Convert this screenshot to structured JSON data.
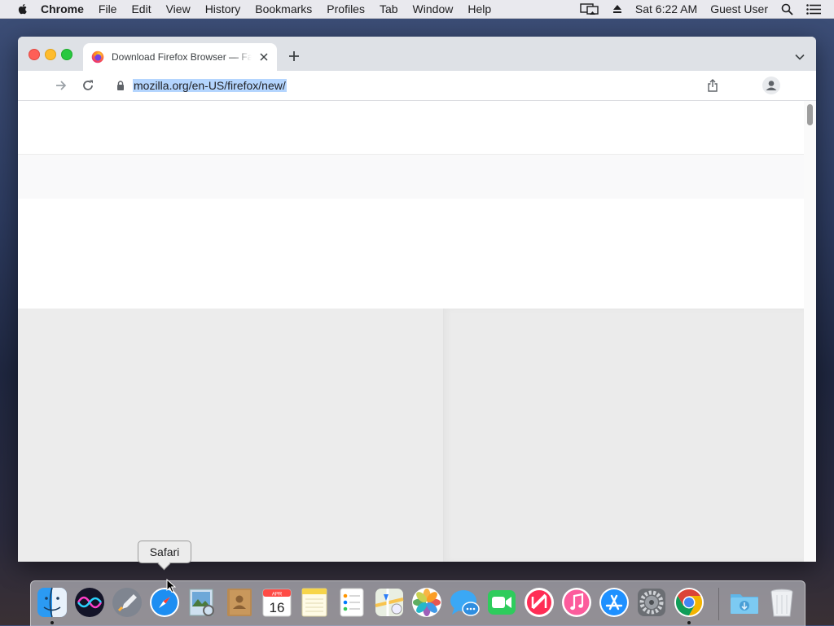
{
  "menubar": {
    "app": "Chrome",
    "items": [
      "File",
      "Edit",
      "View",
      "History",
      "Bookmarks",
      "Profiles",
      "Tab",
      "Window",
      "Help"
    ],
    "clock": "Sat 6:22 AM",
    "user": "Guest User"
  },
  "browser": {
    "tab_title": "Download Firefox Browser — Fast, Private & Free — from Mozilla",
    "url": "mozilla.org/en-US/firefox/new/"
  },
  "tooltip": {
    "text": "Safari"
  },
  "dock": {
    "icons": [
      "finder-icon",
      "siri-icon",
      "launchpad-icon",
      "safari-icon",
      "preview-icon",
      "contacts-icon",
      "calendar-icon",
      "notes-icon",
      "reminders-icon",
      "maps-icon",
      "photos-icon",
      "messages-icon",
      "facetime-icon",
      "news-icon",
      "music-icon",
      "app-store-icon",
      "system-preferences-icon",
      "chrome-icon",
      "downloads-folder-icon",
      "trash-icon"
    ],
    "calendar_month": "APR",
    "calendar_day": "16"
  },
  "colors": {
    "url_selection": "#b4d5fe",
    "traffic_close": "#fe5f57",
    "traffic_min": "#febc2e",
    "traffic_max": "#28c840"
  }
}
